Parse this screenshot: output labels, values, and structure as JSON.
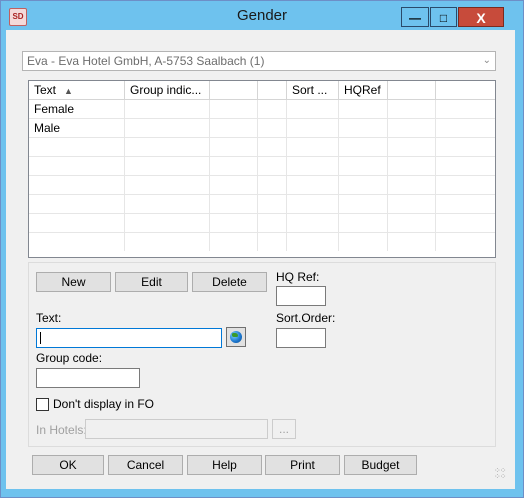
{
  "window": {
    "title": "Gender",
    "app_icon_text": "SD",
    "minimize_glyph": "—",
    "maximize_glyph": "□",
    "close_glyph": "X"
  },
  "hotel_selector": {
    "value": "Eva - Eva Hotel GmbH, A-5753 Saalbach  (1)",
    "arrow": "⌄"
  },
  "grid": {
    "columns": [
      "Text",
      "Group indic...",
      "",
      "",
      "Sort ...",
      "HQRef",
      "",
      ""
    ],
    "sort_indicator": "▲",
    "rows": [
      [
        "Female",
        "",
        "",
        "",
        "",
        "",
        "",
        ""
      ],
      [
        "Male",
        "",
        "",
        "",
        "",
        "",
        "",
        ""
      ]
    ]
  },
  "actions": {
    "new_label": "New",
    "edit_label": "Edit",
    "delete_label": "Delete"
  },
  "form": {
    "text_label": "Text:",
    "text_value": "",
    "group_code_label": "Group code:",
    "group_code_value": "",
    "hq_ref_label": "HQ Ref:",
    "hq_ref_value": "",
    "sort_order_label": "Sort.Order:",
    "sort_order_value": "",
    "dont_display_label": "Don't display in FO",
    "dont_display_checked": false,
    "in_hotels_label": "In Hotels:",
    "in_hotels_value": "",
    "browse_label": "..."
  },
  "footer": {
    "ok_label": "OK",
    "cancel_label": "Cancel",
    "help_label": "Help",
    "print_label": "Print",
    "budget_label": "Budget"
  },
  "colors": {
    "titlebar": "#6ec2ee",
    "close_button": "#c74b3b",
    "client_bg": "#f0f0f0"
  }
}
